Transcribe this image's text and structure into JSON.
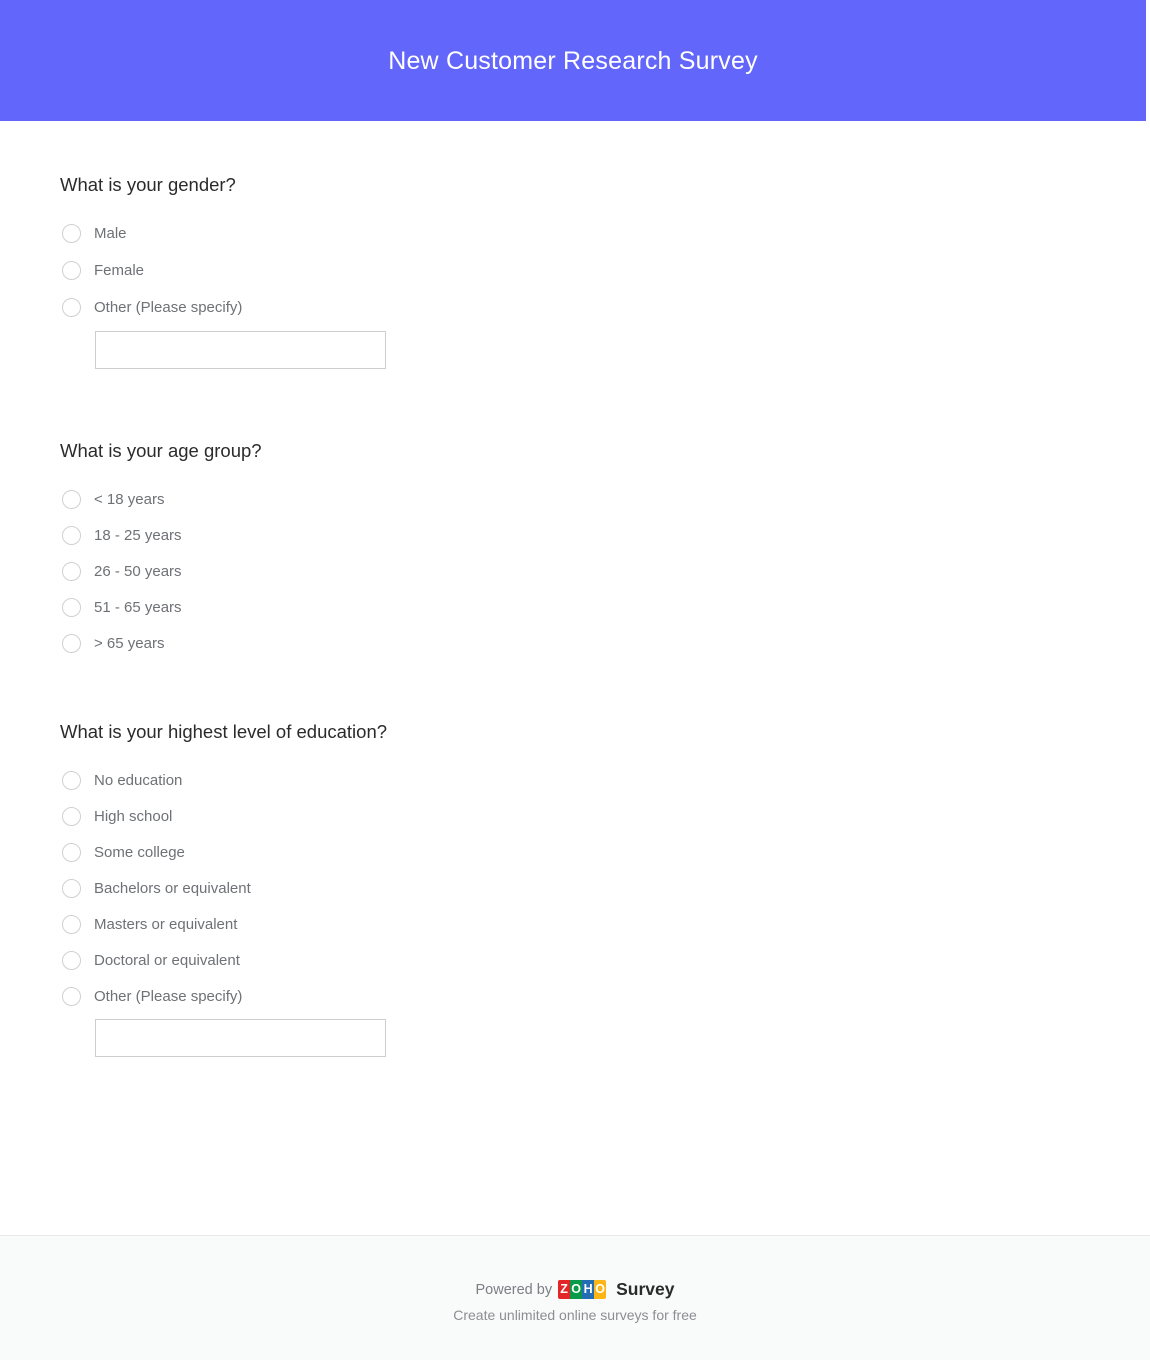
{
  "header": {
    "title": "New Customer Research Survey",
    "background_color": "#6366fa",
    "text_color": "#ffffff"
  },
  "questions": [
    {
      "id": "gender",
      "title": "What is your gender?",
      "type": "radio",
      "options": [
        {
          "label": "Male",
          "selected": false,
          "has_specify_input": false
        },
        {
          "label": "Female",
          "selected": false,
          "has_specify_input": false
        },
        {
          "label": "Other (Please specify)",
          "selected": false,
          "has_specify_input": true
        }
      ],
      "specify_input": {
        "value": "",
        "placeholder": ""
      }
    },
    {
      "id": "age_group",
      "title": "What is your age group?",
      "type": "radio",
      "options": [
        {
          "label": "< 18 years",
          "selected": false,
          "has_specify_input": false
        },
        {
          "label": "18 - 25 years",
          "selected": false,
          "has_specify_input": false
        },
        {
          "label": "26 - 50 years",
          "selected": false,
          "has_specify_input": false
        },
        {
          "label": "51 - 65 years",
          "selected": false,
          "has_specify_input": false
        },
        {
          "label": "> 65 years",
          "selected": false,
          "has_specify_input": false
        }
      ]
    },
    {
      "id": "education",
      "title": "What is your highest level of education?",
      "type": "radio",
      "options": [
        {
          "label": "No education",
          "selected": false,
          "has_specify_input": false
        },
        {
          "label": "High school",
          "selected": false,
          "has_specify_input": false
        },
        {
          "label": "Some college",
          "selected": false,
          "has_specify_input": false
        },
        {
          "label": "Bachelors or equivalent",
          "selected": false,
          "has_specify_input": false
        },
        {
          "label": "Masters or equivalent",
          "selected": false,
          "has_specify_input": false
        },
        {
          "label": "Doctoral or equivalent",
          "selected": false,
          "has_specify_input": false
        },
        {
          "label": "Other (Please specify)",
          "selected": false,
          "has_specify_input": true
        }
      ],
      "specify_input": {
        "value": "",
        "placeholder": ""
      }
    }
  ],
  "footer": {
    "powered_by_text": "Powered by",
    "brand_word": "Survey",
    "tagline": "Create unlimited online surveys for free",
    "logo": {
      "name": "zoho-logo",
      "letters": [
        {
          "char": "Z",
          "color": "#e42527"
        },
        {
          "char": "O",
          "color": "#089949"
        },
        {
          "char": "H",
          "color": "#226db4"
        },
        {
          "char": "O",
          "color": "#fbb515"
        }
      ]
    },
    "background_color": "#f9fafa"
  }
}
